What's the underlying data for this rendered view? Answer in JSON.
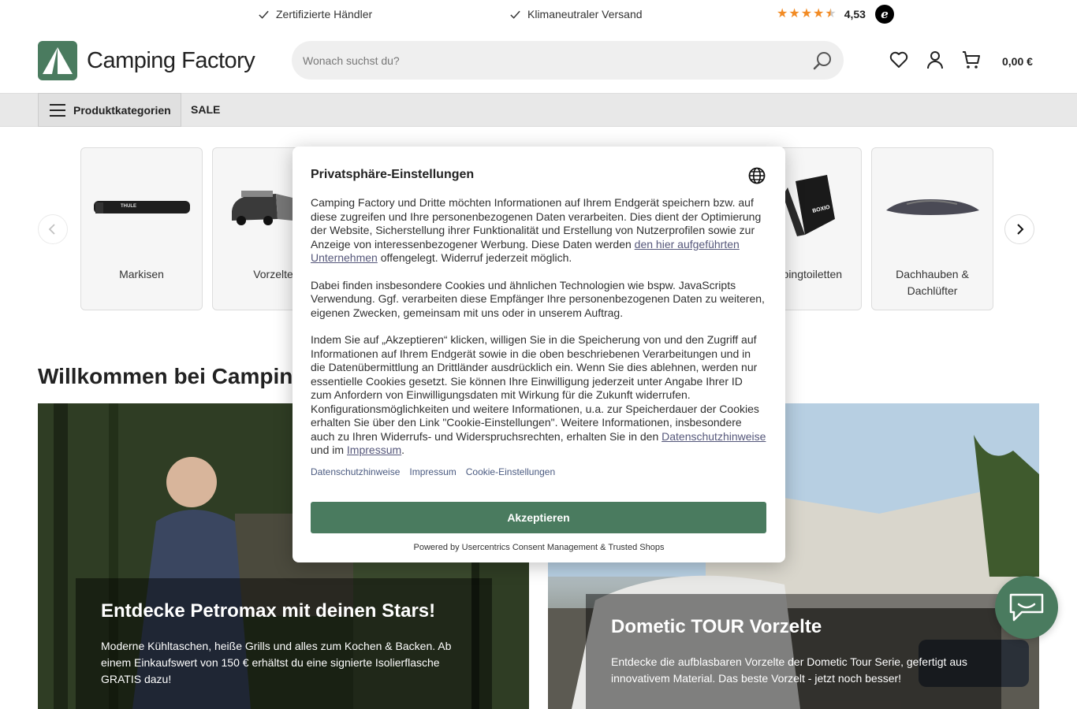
{
  "topbar": {
    "usp1": "Zertifizierte Händler",
    "usp2": "Klimaneutraler Versand",
    "rating_value": "4,53",
    "rating_stars": 4.5,
    "trust_badge": "e"
  },
  "header": {
    "logo_text": "Camping Factory",
    "search_placeholder": "Wonach suchst du?",
    "cart_total": "0,00 €"
  },
  "nav": {
    "categories_label": "Produktkategorien",
    "sale_label": "SALE"
  },
  "categories": [
    {
      "label": "Markisen"
    },
    {
      "label": "Vorzelte"
    },
    {
      "label": "Campingtoiletten"
    },
    {
      "label": "Dachhauben & Dachlüfter"
    }
  ],
  "welcome_heading": "Willkommen bei Campin",
  "banners": [
    {
      "title": "Entdecke Petromax mit deinen Stars!",
      "text": "Moderne Kühltaschen, heiße Grills und alles zum Kochen & Backen. Ab einem Einkaufswert von 150 € erhältst du eine signierte Isolierflasche GRATIS dazu!"
    },
    {
      "title": "Dometic TOUR Vorzelte",
      "text": "Entdecke die aufblasbaren Vorzelte der Dometic Tour Serie, gefertigt aus innovativem Material. Das beste Vorzelt - jetzt noch besser!"
    }
  ],
  "consent": {
    "title": "Privatsphäre-Einstellungen",
    "p1_text": "Camping Factory und Dritte möchten Informationen auf Ihrem Endgerät speichern bzw. auf diese zugreifen und Ihre personenbezogenen Daten verarbeiten. Dies dient der Optimierung der Website, Sicherstellung ihrer Funktionalität und Erstellung von Nutzerprofilen sowie zur Anzeige von interessenbezogener Werbung. Diese Daten werden ",
    "p1_link": "den hier aufgeführten Unternehmen",
    "p1_tail": " offengelegt. Widerruf jederzeit möglich.",
    "p2": "Dabei finden insbesondere Cookies und ähnlichen Technologien wie bspw. JavaScripts Verwendung. Ggf. verarbeiten diese Empfänger Ihre personenbezogenen Daten zu weiteren, eigenen Zwecken, gemeinsam mit uns oder in unserem Auftrag.",
    "p3_text": "Indem Sie auf „Akzeptieren“ klicken, willigen Sie in die Speicherung von und den Zugriff auf Informationen auf Ihrem Endgerät sowie in die oben beschriebenen Verarbeitungen und in die Datenübermittlung an Drittländer ausdrücklich ein. Wenn Sie dies ablehnen, werden nur essentielle Cookies gesetzt. Sie können Ihre Einwilligung jederzeit unter Angabe Ihrer ID zum Anfordern von Einwilligungsdaten mit Wirkung für die Zukunft widerrufen. Konfigurationsmöglichkeiten und weitere Informationen, u.a. zur Speicherdauer der Cookies erhalten Sie über den Link \"Cookie-Einstellungen\". Weitere Informationen, insbesondere auch zu Ihren Widerrufs- und Widerspruchsrechten, erhalten Sie in den ",
    "p3_link1": "Datenschutzhinweise",
    "p3_mid": " und im ",
    "p3_link2": "Impressum",
    "p3_end": ".",
    "link_privacy": "Datenschutzhinweise",
    "link_imprint": "Impressum",
    "link_cookie_settings": "Cookie-Einstellungen",
    "accept_label": "Akzeptieren",
    "powered_by": "Powered by Usercentrics Consent Management & Trusted Shops"
  },
  "colors": {
    "brand_green": "#4a7b5f",
    "star_orange": "#f28b24",
    "link_color": "#55577a"
  }
}
